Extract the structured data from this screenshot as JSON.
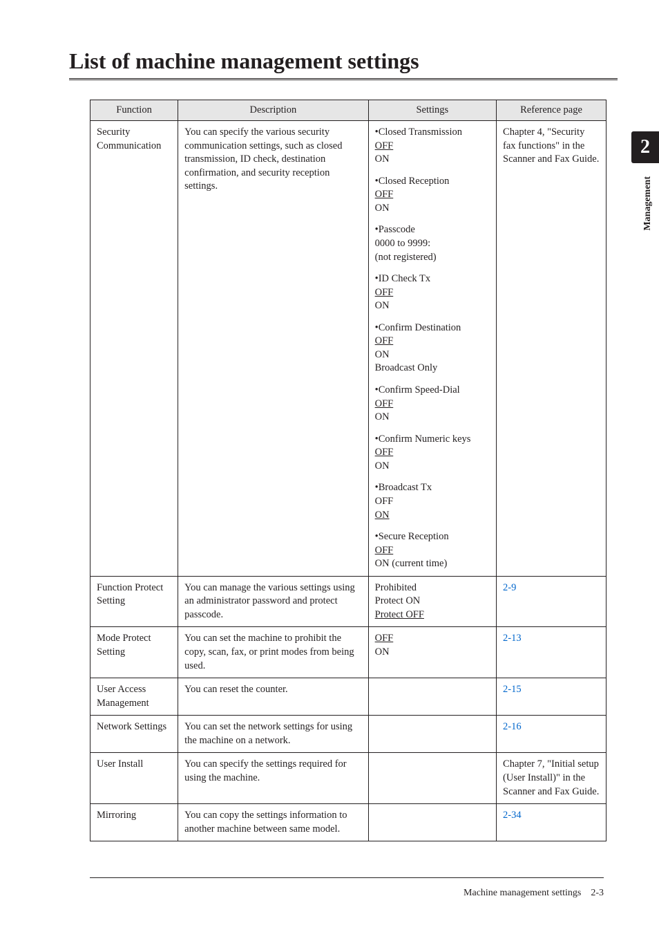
{
  "title": "List of machine management settings",
  "side_tab": {
    "number": "2",
    "label": "Management"
  },
  "headers": {
    "function": "Function",
    "description": "Description",
    "settings": "Settings",
    "reference": "Reference page"
  },
  "rows": {
    "r0": {
      "function": "Security Communication",
      "description": "You can specify the various security communication settings, such as closed transmission, ID check, destination confirmation, and security reception settings.",
      "reference": "Chapter 4, \"Security fax functions\" in the Scanner and Fax Guide.",
      "settings": [
        {
          "name": "Closed Transmission",
          "lines": [
            {
              "t": "OFF",
              "u": true
            },
            {
              "t": "ON"
            }
          ]
        },
        {
          "name": "Closed Reception",
          "lines": [
            {
              "t": "OFF",
              "u": true
            },
            {
              "t": "ON"
            }
          ]
        },
        {
          "name": "Passcode",
          "lines": [
            {
              "t": "0000 to 9999:"
            },
            {
              "t": "(not registered)"
            }
          ]
        },
        {
          "name": "ID Check Tx",
          "lines": [
            {
              "t": "OFF",
              "u": true
            },
            {
              "t": "ON"
            }
          ]
        },
        {
          "name": "Confirm Destination",
          "lines": [
            {
              "t": "OFF",
              "u": true
            },
            {
              "t": "ON"
            },
            {
              "t": "Broadcast Only"
            }
          ]
        },
        {
          "name": "Confirm Speed-Dial",
          "lines": [
            {
              "t": "OFF",
              "u": true
            },
            {
              "t": "ON"
            }
          ]
        },
        {
          "name": "Confirm Numeric keys",
          "lines": [
            {
              "t": "OFF",
              "u": true
            },
            {
              "t": "ON"
            }
          ]
        },
        {
          "name": "Broadcast Tx",
          "lines": [
            {
              "t": "OFF"
            },
            {
              "t": "ON",
              "u": true
            }
          ]
        },
        {
          "name": "Secure Reception",
          "lines": [
            {
              "t": "OFF",
              "u": true
            },
            {
              "t": "ON (current time)"
            }
          ]
        }
      ]
    },
    "r1": {
      "function": "Function Protect Setting",
      "description": "You can manage the various settings using an administrator password and protect passcode.",
      "settings_lines": [
        {
          "t": "Prohibited"
        },
        {
          "t": "Protect ON"
        },
        {
          "t": "Protect OFF",
          "u": true
        }
      ],
      "reference": "2-9",
      "ref_link": true
    },
    "r2": {
      "function": "Mode Protect Setting",
      "description": "You can set the machine to prohibit the copy, scan, fax, or print modes from being used.",
      "settings_lines": [
        {
          "t": "OFF",
          "u": true
        },
        {
          "t": "ON"
        }
      ],
      "reference": "2-13",
      "ref_link": true
    },
    "r3": {
      "function": "User Access Management",
      "description": "You can reset the counter.",
      "settings_lines": [],
      "reference": "2-15",
      "ref_link": true
    },
    "r4": {
      "function": "Network Settings",
      "description": "You can set the network settings for using the machine on a network.",
      "settings_lines": [],
      "reference": "2-16",
      "ref_link": true
    },
    "r5": {
      "function": "User Install",
      "description": "You can specify the settings required for using the machine.",
      "settings_lines": [],
      "reference": "Chapter 7, \"Initial setup (User Install)\" in the Scanner and Fax Guide."
    },
    "r6": {
      "function": "Mirroring",
      "description": "You can copy the settings information to another machine between same model.",
      "settings_lines": [],
      "reference": "2-34",
      "ref_link": true
    }
  },
  "footer": {
    "text": "Machine management settings",
    "page": "2-3"
  }
}
